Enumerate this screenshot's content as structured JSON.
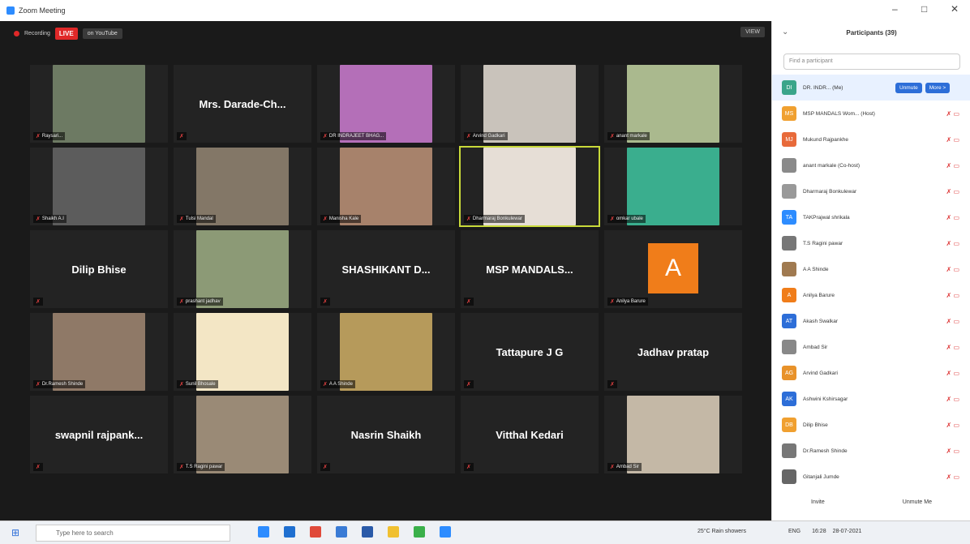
{
  "window": {
    "title": "Zoom Meeting"
  },
  "topbar": {
    "recording": "Recording",
    "live": "LIVE",
    "youtube": "on YouTube",
    "view": "VIEW"
  },
  "tiles": [
    {
      "name": "Raysari...",
      "type": "photo",
      "color": "#6d7a63"
    },
    {
      "name": "",
      "type": "text",
      "big": "Mrs. Darade-Ch..."
    },
    {
      "name": "DR INDRAJEET BHAG...",
      "type": "photo",
      "color": "#b46fb8"
    },
    {
      "name": "Arvind Gadkari",
      "type": "photo",
      "color": "#c9c3bb"
    },
    {
      "name": "anant markale",
      "type": "photo",
      "color": "#aab98e"
    },
    {
      "name": "Shaikh A.I",
      "type": "photo",
      "color": "#5c5c5c"
    },
    {
      "name": "Tulsi Mandal",
      "type": "photo",
      "color": "#837767"
    },
    {
      "name": "Manisha Kale",
      "type": "photo",
      "color": "#a7826b"
    },
    {
      "name": "Dharmaraj Bonkulewar",
      "type": "photo",
      "color": "#e6ded6",
      "active": true
    },
    {
      "name": "omkar ubale",
      "type": "photo",
      "color": "#3aae8e"
    },
    {
      "name": "",
      "type": "text",
      "big": "Dilip Bhise"
    },
    {
      "name": "prashant jadhav",
      "type": "photo",
      "color": "#8c9a76"
    },
    {
      "name": "",
      "type": "text",
      "big": "SHASHIKANT D..."
    },
    {
      "name": "",
      "type": "text",
      "big": "MSP MANDALS..."
    },
    {
      "name": "Anilya Barure",
      "type": "avatar",
      "letter": "A"
    },
    {
      "name": "Dr.Ramesh Shinde",
      "type": "photo",
      "color": "#8f7967"
    },
    {
      "name": "Sunil Bhosale",
      "type": "photo",
      "color": "#f3e6c5"
    },
    {
      "name": "A A Shinde",
      "type": "photo",
      "color": "#b69a5b"
    },
    {
      "name": "",
      "type": "text",
      "big": "Tattapure J G"
    },
    {
      "name": "",
      "type": "text",
      "big": "Jadhav pratap"
    },
    {
      "name": "",
      "type": "text",
      "big": "swapnil rajpank..."
    },
    {
      "name": "T.S Ragini pawar",
      "type": "photo",
      "color": "#9a8a76"
    },
    {
      "name": "",
      "type": "text",
      "big": "Nasrin Shaikh"
    },
    {
      "name": "",
      "type": "text",
      "big": "Vitthal Kedari"
    },
    {
      "name": "Ambad Sir",
      "type": "photo",
      "color": "#c4b8a6"
    }
  ],
  "participants": {
    "title": "Participants (39)",
    "search_placeholder": "Find a participant",
    "unmute_label": "Unmute",
    "more_label": "More >",
    "items": [
      {
        "name": "DR. INDR... (Me)",
        "initials": "DI",
        "color": "#3aa58a"
      },
      {
        "name": "MSP MANDALS Wom... (Host)",
        "initials": "MS",
        "color": "#f0a030"
      },
      {
        "name": "Mukund Rajpankhe",
        "initials": "MJ",
        "color": "#e86a3a"
      },
      {
        "name": "anant markale (Co-host)",
        "initials": "",
        "color": "#8a8a8a"
      },
      {
        "name": "Dharmaraj Bonkulewar",
        "initials": "",
        "color": "#999"
      },
      {
        "name": "TAKPrajwal shrikala",
        "initials": "TA",
        "color": "#2d8cff"
      },
      {
        "name": "T.S Ragini pawar",
        "initials": "",
        "color": "#777"
      },
      {
        "name": "A A Shinde",
        "initials": "",
        "color": "#a07a50"
      },
      {
        "name": "Anilya Barure",
        "initials": "A",
        "color": "#f07d1a"
      },
      {
        "name": "Akash Swalkar",
        "initials": "AT",
        "color": "#2d6ed8"
      },
      {
        "name": "Ambad Sir",
        "initials": "",
        "color": "#888"
      },
      {
        "name": "Arvind Gadkari",
        "initials": "AG",
        "color": "#e8922a"
      },
      {
        "name": "Ashwini Kshirsagar",
        "initials": "AK",
        "color": "#2d6ed8"
      },
      {
        "name": "Dilip Bhise",
        "initials": "DB",
        "color": "#f0a030"
      },
      {
        "name": "Dr.Ramesh Shinde",
        "initials": "",
        "color": "#777"
      },
      {
        "name": "Gitanjali Jumde",
        "initials": "",
        "color": "#666"
      }
    ],
    "invite_label": "Invite",
    "unmute_me_label": "Unmute Me"
  },
  "taskbar": {
    "search_placeholder": "Type here to search",
    "weather": "25°C  Rain showers",
    "lang": "ENG",
    "time": "16:28",
    "date": "28-07-2021"
  }
}
